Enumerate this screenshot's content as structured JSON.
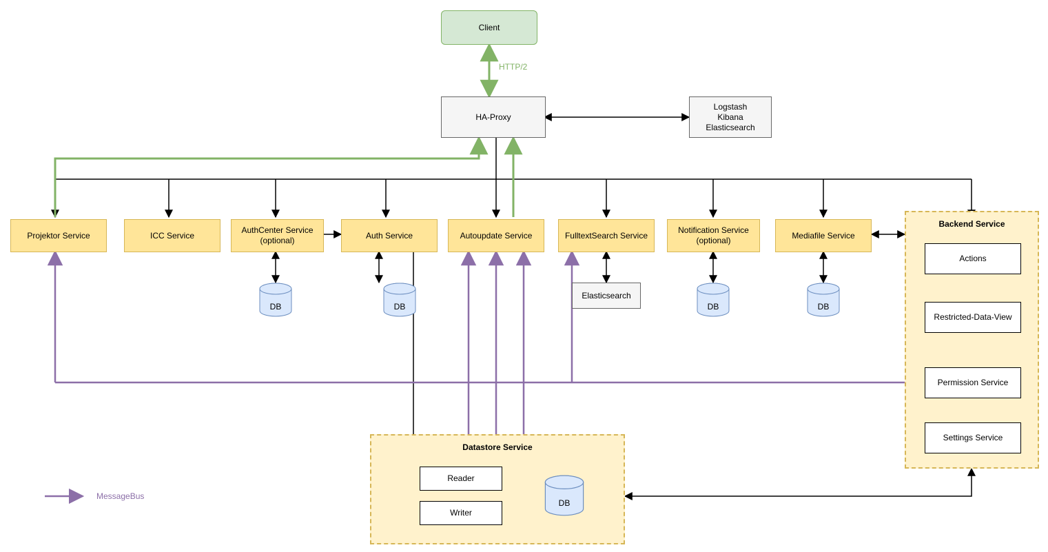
{
  "client": "Client",
  "httpLabel": "HTTP/2",
  "haproxy": "HA-Proxy",
  "logstack": "Logstash\nKibana\nElasticsearch",
  "services": {
    "projektor": "Projektor Service",
    "icc": "ICC Service",
    "authcenter": "AuthCenter Service\n(optional)",
    "auth": "Auth Service",
    "autoupdate": "Autoupdate Service",
    "fulltext": "FulltextSearch Service",
    "notification": "Notification Service\n(optional)",
    "mediafile": "Mediafile Service"
  },
  "elasticsearch": "Elasticsearch",
  "backend": {
    "title": "Backend Service",
    "actions": "Actions",
    "restricted": "Restricted-Data-View",
    "permission": "Permission Service",
    "settings": "Settings Service"
  },
  "datastore": {
    "title": "Datastore Service",
    "reader": "Reader",
    "writer": "Writer"
  },
  "dbLabel": "DB",
  "legend": "MessageBus"
}
